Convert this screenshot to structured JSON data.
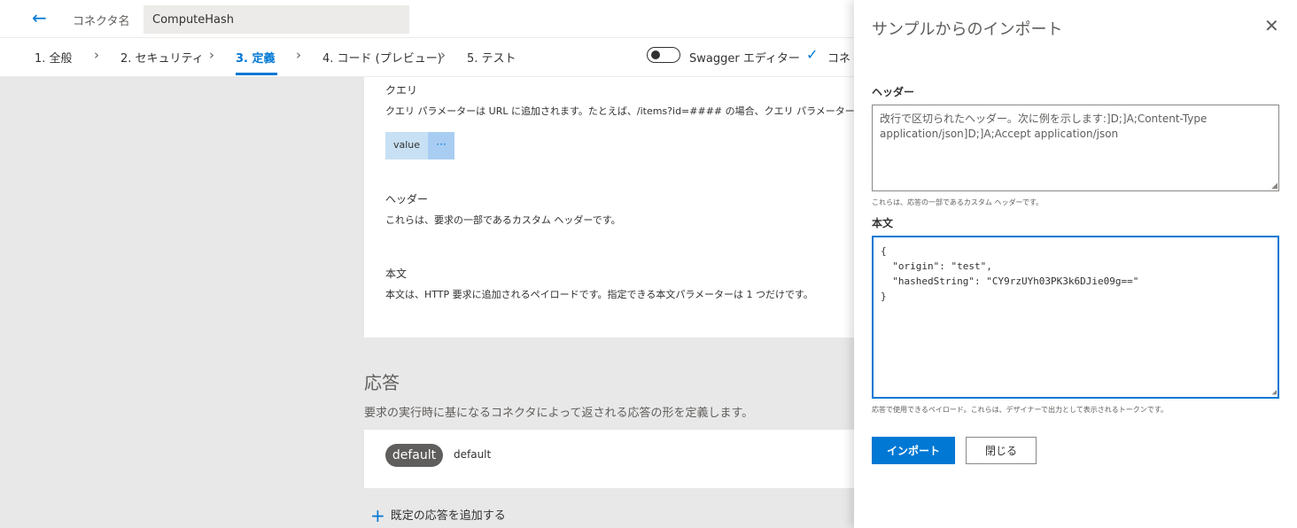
{
  "header": {
    "back_icon": "arrow-left-icon",
    "connector_label": "コネクタ名",
    "connector_name": "ComputeHash"
  },
  "steps": [
    {
      "label": "1. 全般",
      "active": false
    },
    {
      "label": "2. セキュリティ",
      "active": false
    },
    {
      "label": "3. 定義",
      "active": true
    },
    {
      "label": "4. コード (プレビュー)",
      "active": false
    },
    {
      "label": "5. テスト",
      "active": false
    }
  ],
  "toolbar": {
    "swagger_label": "Swagger エディター",
    "swagger_enabled": false,
    "check_label": "コネ"
  },
  "request": {
    "query_title": "クエリ",
    "query_desc": "クエリ パラメーターは URL に追加されます。たとえば、/items?id=#### の場合、クエリ パラメーターは id です。",
    "param_value": "value",
    "param_more": "···",
    "headers_title": "ヘッダー",
    "headers_desc": "これらは、要求の一部であるカスタム ヘッダーです。",
    "body_title": "本文",
    "body_desc": "本文は、HTTP 要求に追加されるペイロードです。指定できる本文パラメーターは 1 つだけです。"
  },
  "response": {
    "title": "応答",
    "desc": "要求の実行時に基になるコネクタによって返される応答の形を定義します。",
    "default_badge": "default",
    "default_text": "default",
    "add_label": "既定の応答を追加する"
  },
  "panel": {
    "title": "サンプルからのインポート",
    "close_icon": "close-icon",
    "headers_label": "ヘッダー",
    "headers_placeholder": "改行で区切られたヘッダー。次に例を示します:]D;]A;Content-Type application/json]D;]A;Accept application/json",
    "headers_hint": "これらは、応答の一部であるカスタム ヘッダーです。",
    "body_label": "本文",
    "body_value": "{\n  \"origin\": \"test\",\n  \"hashedString\": \"CY9rzUYh03PK3k6DJie09g==\"\n}",
    "body_hint": "応答で使用できるペイロード。これらは、デザイナーで出力として表示されるトークンです。",
    "import_button": "インポート",
    "close_button": "閉じる"
  },
  "colors": {
    "accent": "#0078d4",
    "badge": "#605e5c",
    "canvas": "#e8e8e8"
  }
}
